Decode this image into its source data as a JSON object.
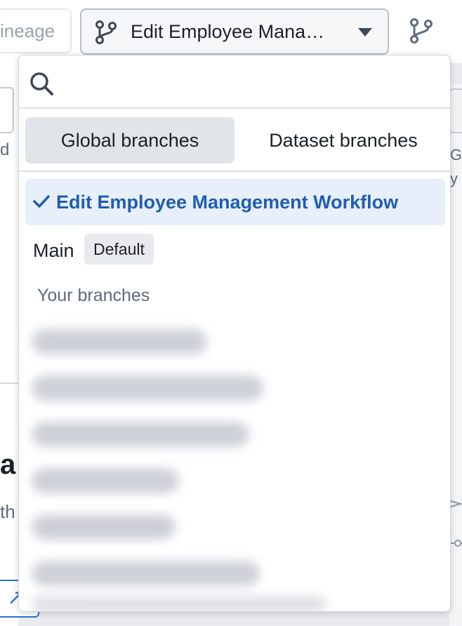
{
  "toolbar": {
    "lineage_tab_label": "ineage",
    "current_branch_label": "Edit Employee Mana…"
  },
  "branch_dropdown": {
    "search_placeholder": "",
    "tabs": [
      {
        "label": "Global branches",
        "active": true
      },
      {
        "label": "Dataset branches",
        "active": false
      }
    ],
    "selected_branch": "Edit Employee Management Workflow",
    "default_branch": {
      "label": "Main",
      "badge": "Default"
    },
    "your_branches_heading": "Your branches"
  },
  "background": {
    "left_fragment_d": "d",
    "left_fragment_heading": "a",
    "left_fragment_text": "th",
    "right_fragment_text": "Gr\ny"
  },
  "colors": {
    "accent": "#215db0",
    "selected_bg": "#e7effb",
    "active_tab_bg": "#e1e4e8",
    "badge_bg": "#e8eaed"
  }
}
